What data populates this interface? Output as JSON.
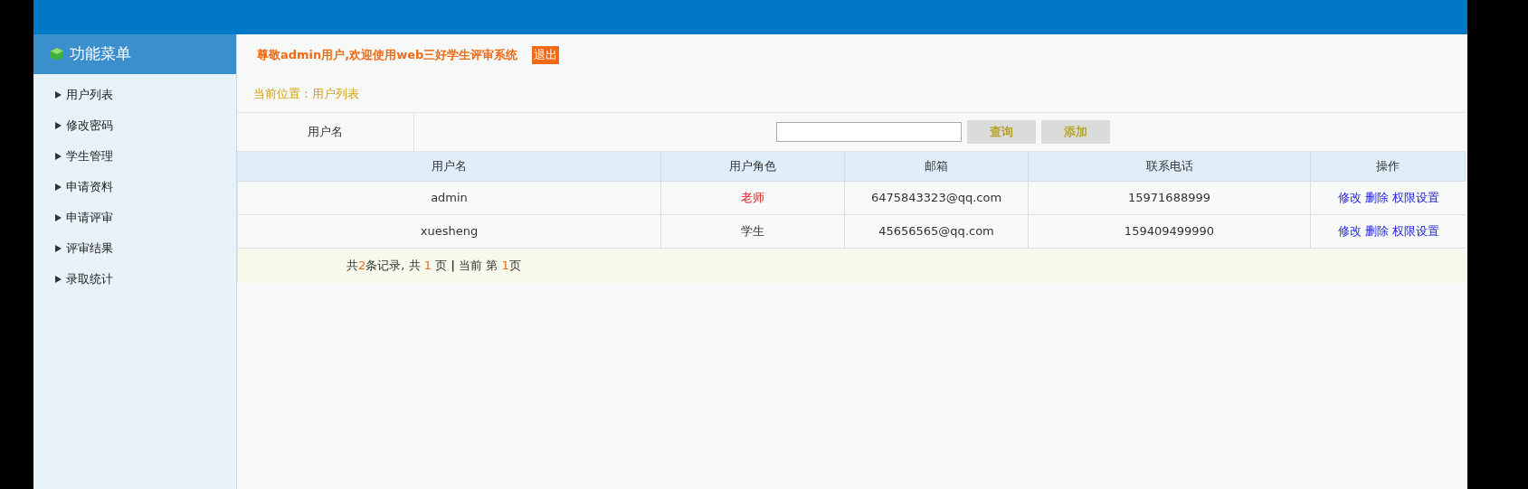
{
  "sidebar": {
    "title": "功能菜单",
    "items": [
      {
        "label": "用户列表"
      },
      {
        "label": "修改密码"
      },
      {
        "label": "学生管理"
      },
      {
        "label": "申请资料"
      },
      {
        "label": "申请评审"
      },
      {
        "label": "评审结果"
      },
      {
        "label": "录取统计"
      }
    ]
  },
  "welcome": "尊敬admin用户,欢迎使用web三好学生评审系统",
  "logout": "退出",
  "breadcrumb": "当前位置：用户列表",
  "search": {
    "label": "用户名",
    "buttons": [
      "查询",
      "添加"
    ]
  },
  "table": {
    "columns": [
      "用户名",
      "用户角色",
      "邮箱",
      "联系电话",
      "操作"
    ],
    "rows": [
      {
        "username": "admin",
        "role": {
          "text": "老师",
          "highlight": true
        },
        "email": "6475843323@qq.com",
        "phone": "15971688999",
        "actions": [
          "修改",
          "删除",
          "权限设置"
        ]
      },
      {
        "username": "xuesheng",
        "role": {
          "text": "学生",
          "highlight": false
        },
        "email": "45656565@qq.com",
        "phone": "159409499990",
        "actions": [
          "修改",
          "删除",
          "权限设置"
        ]
      }
    ]
  },
  "pagination": [
    {
      "text": "共",
      "highlight": false
    },
    {
      "text": "2",
      "highlight": true
    },
    {
      "text": "条记录, 共 ",
      "highlight": false
    },
    {
      "text": "1",
      "highlight": true
    },
    {
      "text": " 页 ",
      "highlight": false
    },
    {
      "text": "|",
      "highlight": false,
      "bold": true
    },
    {
      "text": " 当前 第 ",
      "highlight": false
    },
    {
      "text": "1",
      "highlight": true
    },
    {
      "text": "页",
      "highlight": false
    }
  ]
}
